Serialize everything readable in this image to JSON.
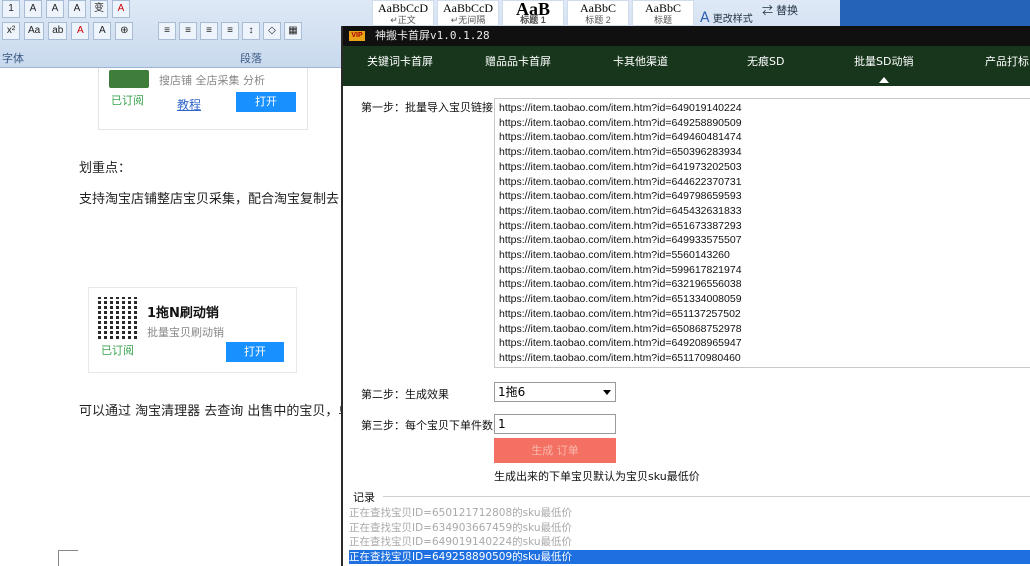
{
  "word": {
    "row1_buttons": [
      "1",
      "A",
      "A",
      "A",
      "变",
      "A"
    ],
    "row2_buttons": [
      "x²",
      "Aa",
      "ab",
      "A",
      "A",
      "⊕"
    ],
    "para_buttons": [
      "≡",
      "≡",
      "≡",
      "≡",
      "↕",
      "◇",
      "▦"
    ],
    "group_font": "字体",
    "group_para": "段落",
    "styles": [
      {
        "sample": "AaBbCcD",
        "name": "↵正文"
      },
      {
        "sample": "AaBbCcD",
        "name": "↵无间隔"
      },
      {
        "sample": "AaB",
        "name": "标题 1"
      },
      {
        "sample": "AaBbC",
        "name": "标题 2"
      },
      {
        "sample": "AaBbC",
        "name": "标题"
      }
    ],
    "change_styles": "更改样式",
    "replace": "替换"
  },
  "doc": {
    "card1": {
      "desc": "搜店铺 全店采集 分析",
      "subscribed": "已订阅",
      "tutorial": "教程",
      "open": "打开"
    },
    "heading": "划重点：",
    "para1": "支持淘宝店铺整店宝贝采集，配合淘宝复制去",
    "card2": {
      "title": "1拖N刷动销",
      "subtitle": "批量宝贝刷动销",
      "subscribed": "已订阅",
      "open": "打开"
    },
    "para2": "可以通过 淘宝清理器 去查询 出售中的宝贝，单"
  },
  "app": {
    "vip_badge": "VIP",
    "title": "神搬卡首屏v1.0.1.28",
    "nav": [
      {
        "label": "关键词卡首屏",
        "active": false
      },
      {
        "label": "赠品品卡首屏",
        "active": false
      },
      {
        "label": "卡其他渠道",
        "active": false
      },
      {
        "label": "无痕SD",
        "active": false
      },
      {
        "label": "批量SD动销",
        "active": true
      },
      {
        "label": "产品打标",
        "active": false
      }
    ],
    "step1_label": "第一步：批量导入宝贝链接",
    "urls": [
      "https://item.taobao.com/item.htm?id=649019140224",
      "https://item.taobao.com/item.htm?id=649258890509",
      "https://item.taobao.com/item.htm?id=649460481474",
      "https://item.taobao.com/item.htm?id=650396283934",
      "https://item.taobao.com/item.htm?id=641973202503",
      "https://item.taobao.com/item.htm?id=644622370731",
      "https://item.taobao.com/item.htm?id=649798659593",
      "https://item.taobao.com/item.htm?id=645432631833",
      "https://item.taobao.com/item.htm?id=651673387293",
      "https://item.taobao.com/item.htm?id=649933575507",
      "https://item.taobao.com/item.htm?id=5560143260",
      "https://item.taobao.com/item.htm?id=599617821974",
      "https://item.taobao.com/item.htm?id=632196556038",
      "https://item.taobao.com/item.htm?id=651334008059",
      "https://item.taobao.com/item.htm?id=651137257502",
      "https://item.taobao.com/item.htm?id=650868752978",
      "https://item.taobao.com/item.htm?id=649208965947",
      "https://item.taobao.com/item.htm?id=651170980460"
    ],
    "step2_label": "第二步：生成效果",
    "effect_value": "1拖6",
    "step3_label": "第三步：每个宝贝下单件数",
    "quantity_value": "1",
    "generate_button": "生成 订单",
    "note": "生成出来的下单宝贝默认为宝贝sku最低价",
    "log_label": "记录",
    "log": [
      {
        "text": "正在查找宝贝ID=650121712808的sku最低价",
        "selected": false
      },
      {
        "text": "正在查找宝贝ID=634903667459的sku最低价",
        "selected": false
      },
      {
        "text": "正在查找宝贝ID=649019140224的sku最低价",
        "selected": false
      },
      {
        "text": "正在查找宝贝ID=649258890509的sku最低价",
        "selected": true
      }
    ]
  }
}
